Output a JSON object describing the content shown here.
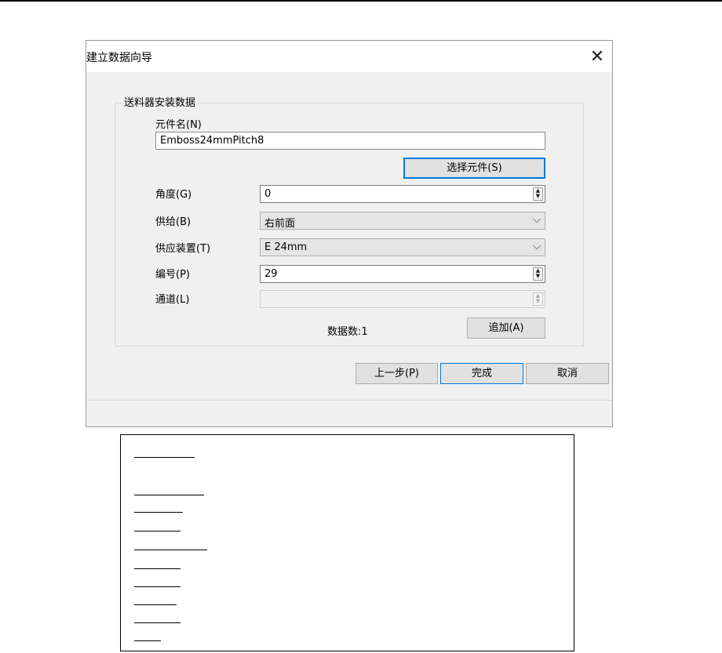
{
  "window": {
    "title": "建立数据向导",
    "close_glyph": "✕"
  },
  "group": {
    "legend": "送料器安装数据"
  },
  "component_name": {
    "label": "元件名(N)",
    "value": "Emboss24mmPitch8"
  },
  "buttons": {
    "select_component": "选择元件(S)",
    "add": "追加(A)",
    "back": "上一步(P)",
    "finish": "完成",
    "cancel": "取消"
  },
  "fields": {
    "angle": {
      "label": "角度(G)",
      "value": "0"
    },
    "supply": {
      "label": "供给(B)",
      "value": "右前面"
    },
    "feeder_device": {
      "label": "供应装置(T)",
      "value": "E 24mm"
    },
    "number": {
      "label": "编号(P)",
      "value": "29"
    },
    "channel": {
      "label": "通道(L)",
      "value": ""
    }
  },
  "data_count": {
    "label": "数据数:",
    "value": "1"
  }
}
